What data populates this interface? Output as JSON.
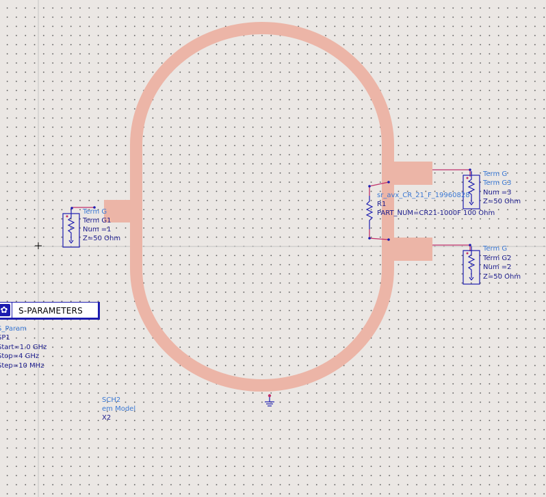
{
  "schematic": {
    "substrate_color": "#ecb5a7",
    "wire_color": "#c0306a",
    "component_color": "#1c1cb0",
    "label_color": "#3a78d4",
    "text_color": "#1a1a8c"
  },
  "terms": {
    "g1": {
      "type": "Term G",
      "name": "Term G1",
      "num": "Num =1",
      "z": "Z=50 Ohm"
    },
    "g2": {
      "type": "Term G",
      "name": "Term G2",
      "num": "Num =2",
      "z": "Z=50 Ohm"
    },
    "g3": {
      "type": "Term G",
      "name": "Term G3",
      "num": "Num =3",
      "z": "Z=50 Ohm"
    }
  },
  "resistor": {
    "model": "sr_avx_CR_21_F_19960828",
    "name": "R1",
    "part": "PART_NUM=CR21-1000F 100 Ohm"
  },
  "sparams": {
    "title": "S-PARAMETERS",
    "type": "S_Param",
    "name": "SP1",
    "start": "Start=1.0 GHz",
    "stop": "Stop=4 GHz",
    "step": "Step=10 MHz"
  },
  "em_model": {
    "name": "SCH2",
    "type": "em Model",
    "instance": "X2"
  }
}
